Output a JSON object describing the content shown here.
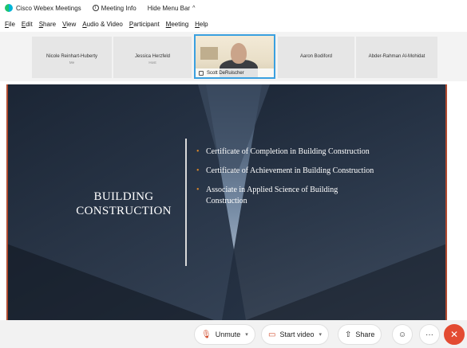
{
  "titlebar": {
    "app_name": "Cisco Webex Meetings",
    "meeting_info": "Meeting Info",
    "hide_menu_bar": "Hide Menu Bar"
  },
  "menubar": {
    "items": [
      "File",
      "Edit",
      "Share",
      "View",
      "Audio & Video",
      "Participant",
      "Meeting",
      "Help"
    ]
  },
  "participants": [
    {
      "name": "Nicole Reinhart-Huberty",
      "role": "Me"
    },
    {
      "name": "Jessica Herzfeld",
      "role": "Host"
    },
    {
      "name": "Aaron Bodiford",
      "role": ""
    },
    {
      "name": "Abder-Rahman Al-Mohidat",
      "role": ""
    }
  ],
  "active_speaker": {
    "name": "Scott DeRuischer"
  },
  "slide": {
    "title_line1": "BUILDING",
    "title_line2": "CONSTRUCTION",
    "bullets": [
      "Certificate of Completion in Building Construction",
      "Certificate of Achievement in Building Construction",
      "Associate in Applied Science of Building Construction"
    ]
  },
  "controls": {
    "unmute": "Unmute",
    "start_video": "Start video",
    "share": "Share"
  },
  "colors": {
    "accent_blue": "#3aa0e0",
    "leave_red": "#e34b32",
    "bullet_orange": "#d9872b"
  }
}
